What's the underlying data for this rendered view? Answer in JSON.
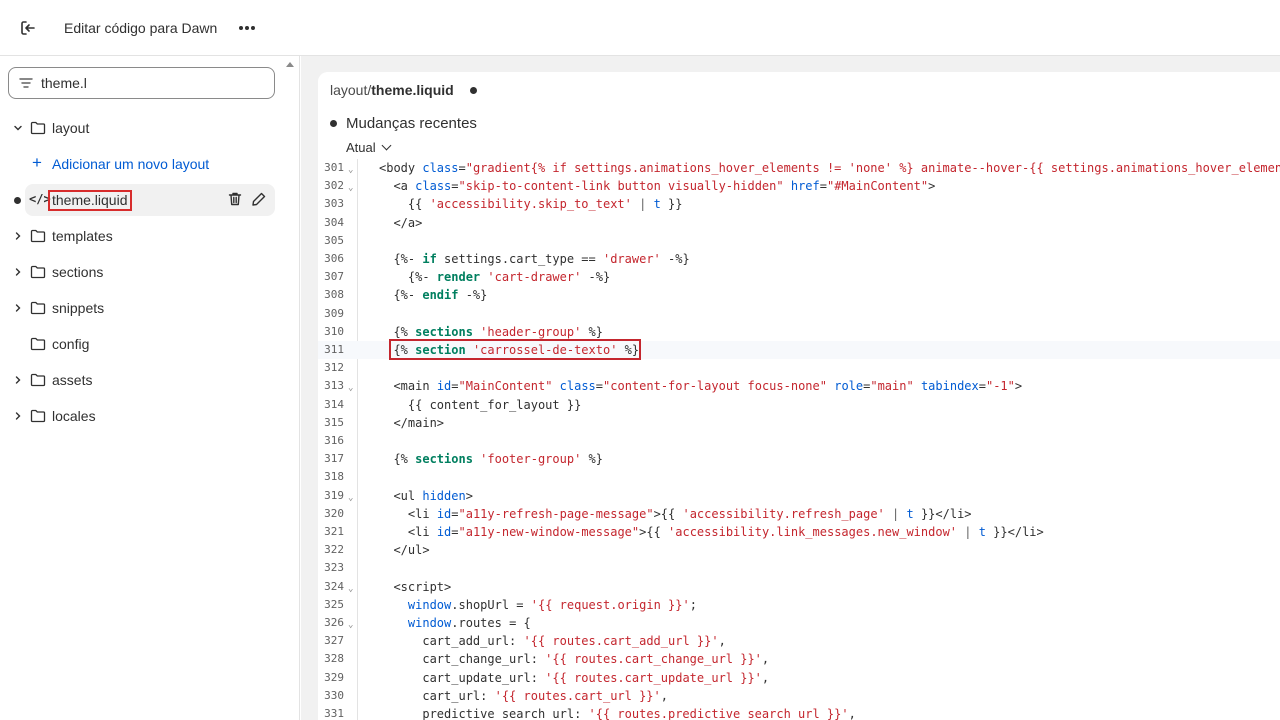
{
  "topbar": {
    "title": "Editar código para Dawn"
  },
  "sidebar": {
    "search_value": "theme.l",
    "tree": {
      "layout": "layout",
      "add_layout": "Adicionar um novo layout",
      "active_file": "theme.liquid",
      "templates": "templates",
      "sections": "sections",
      "snippets": "snippets",
      "config": "config",
      "assets": "assets",
      "locales": "locales"
    }
  },
  "editor": {
    "tab_path": "layout/",
    "tab_file": "theme.liquid",
    "recent_changes": "Mudanças recentes",
    "version": "Atual",
    "code_icon": "</>",
    "lines": [
      {
        "n": "301",
        "fold": true,
        "html": "<span class=\"t-tag\">&lt;body </span><span class=\"t-attr\">class</span>=<span class=\"t-str\">\"gradient{% if settings.animations_hover_elements != 'none' %} animate--hover-{{ settings.animations_hover_elements }}\"</span>"
      },
      {
        "n": "302",
        "fold": true,
        "html": "  <span class=\"t-tag\">&lt;a </span><span class=\"t-attr\">class</span>=<span class=\"t-str\">\"skip-to-content-link button visually-hidden\"</span> <span class=\"t-attr\">href</span>=<span class=\"t-str\">\"#MainContent\"</span>&gt;"
      },
      {
        "n": "303",
        "fold": false,
        "html": "    {{ <span class=\"t-str\">'accessibility.skip_to_text'</span> <span class=\"t-pipe\">|</span> <span class=\"t-attr\">t</span> }}"
      },
      {
        "n": "304",
        "fold": false,
        "html": "  &lt;/a&gt;"
      },
      {
        "n": "305",
        "fold": false,
        "html": ""
      },
      {
        "n": "306",
        "fold": false,
        "html": "  {%- <span class=\"t-kw\">if</span> settings.cart_type == <span class=\"t-str\">'drawer'</span> -%}"
      },
      {
        "n": "307",
        "fold": false,
        "html": "    {%- <span class=\"t-kw\">render</span> <span class=\"t-str\">'cart-drawer'</span> -%}"
      },
      {
        "n": "308",
        "fold": false,
        "html": "  {%- <span class=\"t-kw\">endif</span> -%}"
      },
      {
        "n": "309",
        "fold": false,
        "html": ""
      },
      {
        "n": "310",
        "fold": false,
        "html": "  {% <span class=\"t-kw\">sections</span> <span class=\"t-str\">'header-group'</span> %}"
      },
      {
        "n": "311",
        "fold": false,
        "html": "  {% <span class=\"t-kw\">section</span> <span class=\"t-str\">'carrossel-de-texto'</span> %}"
      },
      {
        "n": "312",
        "fold": false,
        "html": ""
      },
      {
        "n": "313",
        "fold": true,
        "html": "  <span class=\"t-tag\">&lt;main </span><span class=\"t-attr\">id</span>=<span class=\"t-str\">\"MainContent\"</span> <span class=\"t-attr\">class</span>=<span class=\"t-str\">\"content-for-layout focus-none\"</span> <span class=\"t-attr\">role</span>=<span class=\"t-str\">\"main\"</span> <span class=\"t-attr\">tabindex</span>=<span class=\"t-str\">\"-1\"</span>&gt;"
      },
      {
        "n": "314",
        "fold": false,
        "html": "    {{ content_for_layout }}"
      },
      {
        "n": "315",
        "fold": false,
        "html": "  &lt;/main&gt;"
      },
      {
        "n": "316",
        "fold": false,
        "html": ""
      },
      {
        "n": "317",
        "fold": false,
        "html": "  {% <span class=\"t-kw\">sections</span> <span class=\"t-str\">'footer-group'</span> %}"
      },
      {
        "n": "318",
        "fold": false,
        "html": ""
      },
      {
        "n": "319",
        "fold": true,
        "html": "  <span class=\"t-tag\">&lt;ul </span><span class=\"t-attr\">hidden</span>&gt;"
      },
      {
        "n": "320",
        "fold": false,
        "html": "    <span class=\"t-tag\">&lt;li </span><span class=\"t-attr\">id</span>=<span class=\"t-str\">\"a11y-refresh-page-message\"</span>&gt;{{ <span class=\"t-str\">'accessibility.refresh_page'</span> <span class=\"t-pipe\">|</span> <span class=\"t-attr\">t</span> }}&lt;/li&gt;"
      },
      {
        "n": "321",
        "fold": false,
        "html": "    <span class=\"t-tag\">&lt;li </span><span class=\"t-attr\">id</span>=<span class=\"t-str\">\"a11y-new-window-message\"</span>&gt;{{ <span class=\"t-str\">'accessibility.link_messages.new_window'</span> <span class=\"t-pipe\">|</span> <span class=\"t-attr\">t</span> }}&lt;/li&gt;"
      },
      {
        "n": "322",
        "fold": false,
        "html": "  &lt;/ul&gt;"
      },
      {
        "n": "323",
        "fold": false,
        "html": ""
      },
      {
        "n": "324",
        "fold": true,
        "html": "  <span class=\"t-tag\">&lt;script&gt;</span>"
      },
      {
        "n": "325",
        "fold": false,
        "html": "    <span class=\"t-attr\">window</span>.shopUrl = <span class=\"t-str\">'{{ request.origin }}'</span>;"
      },
      {
        "n": "326",
        "fold": true,
        "html": "    <span class=\"t-attr\">window</span>.routes = {"
      },
      {
        "n": "327",
        "fold": false,
        "html": "      cart_add_url: <span class=\"t-str\">'{{ routes.cart_add_url }}'</span>,"
      },
      {
        "n": "328",
        "fold": false,
        "html": "      cart_change_url: <span class=\"t-str\">'{{ routes.cart_change_url }}'</span>,"
      },
      {
        "n": "329",
        "fold": false,
        "html": "      cart_update_url: <span class=\"t-str\">'{{ routes.cart_update_url }}'</span>,"
      },
      {
        "n": "330",
        "fold": false,
        "html": "      cart_url: <span class=\"t-str\">'{{ routes.cart_url }}'</span>,"
      },
      {
        "n": "331",
        "fold": false,
        "html": "      predictive_search_url: <span class=\"t-str\">'{{ routes.predictive_search_url }}'</span>,"
      }
    ]
  }
}
